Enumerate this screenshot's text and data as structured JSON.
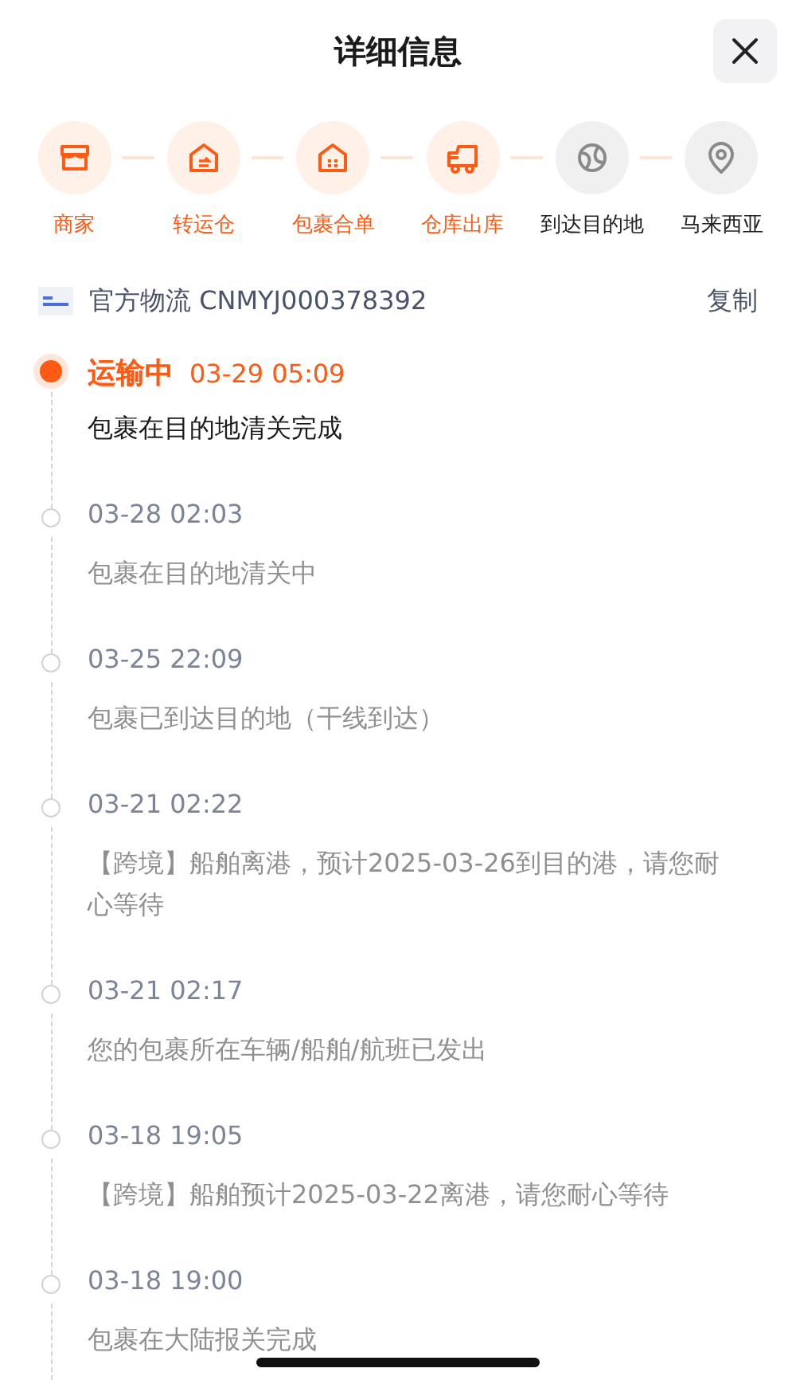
{
  "header": {
    "title": "详细信息"
  },
  "stages": [
    {
      "label": "商家",
      "done": true,
      "kind": "shop"
    },
    {
      "label": "转运仓",
      "done": true,
      "kind": "transfer"
    },
    {
      "label": "包裹合单",
      "done": true,
      "kind": "house"
    },
    {
      "label": "仓库出库",
      "done": true,
      "kind": "truck"
    },
    {
      "label": "到达目的地",
      "done": false,
      "kind": "globe"
    },
    {
      "label": "马来西亚",
      "done": false,
      "kind": "pin"
    }
  ],
  "carrier": {
    "text": "官方物流 CNMYJ000378392",
    "copy": "复制"
  },
  "events": [
    {
      "current": true,
      "status": "运输中",
      "time": "03-29 05:09",
      "text": "包裹在目的地清关完成"
    },
    {
      "current": false,
      "time": "03-28 02:03",
      "text": "包裹在目的地清关中"
    },
    {
      "current": false,
      "time": "03-25 22:09",
      "text": "包裹已到达目的地（干线到达）"
    },
    {
      "current": false,
      "time": "03-21 02:22",
      "text": "【跨境】船舶离港，预计2025-03-26到目的港，请您耐心等待"
    },
    {
      "current": false,
      "time": "03-21 02:17",
      "text": "您的包裹所在车辆/船舶/航班已发出"
    },
    {
      "current": false,
      "time": "03-18 19:05",
      "text": "【跨境】船舶预计2025-03-22离港，请您耐心等待"
    },
    {
      "current": false,
      "time": "03-18 19:00",
      "text": "包裹在大陆报关完成"
    }
  ]
}
